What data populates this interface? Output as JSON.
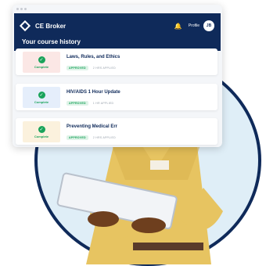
{
  "window": {
    "brand": "CE Broker",
    "profile_label": "Profile",
    "avatar_initials": "JB",
    "section_title": "Your course history"
  },
  "courses": [
    {
      "title": "Laws, Rules, and Ethics",
      "thumb_label": "Complete",
      "status": "APPROVED",
      "meta": "2 HRS APPLIED"
    },
    {
      "title": "HIV/AIDS 1 Hour Update",
      "thumb_label": "Complete",
      "status": "APPROVED",
      "meta": "1 HR APPLIED"
    },
    {
      "title": "Preventing Medical Err",
      "thumb_label": "Complete",
      "status": "APPROVED",
      "meta": "2 HRS APPLIED"
    }
  ],
  "colors": {
    "brand_navy": "#0f2a5a",
    "success_green": "#19a35a",
    "circle_bg": "#dfeef7"
  },
  "icons": {
    "logo": "ce-broker-logo-icon",
    "bell": "bell-icon",
    "check": "check-circle-icon"
  }
}
